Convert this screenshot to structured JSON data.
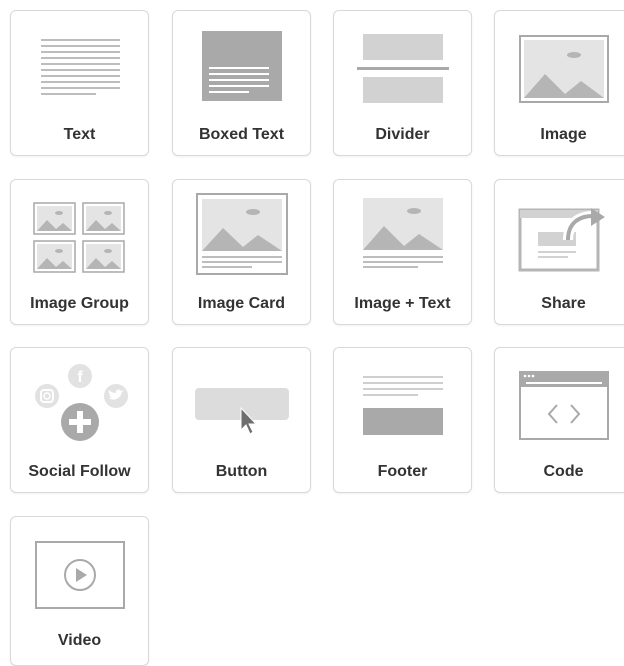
{
  "blocks": [
    {
      "label": "Text",
      "icon": "text-lines-icon"
    },
    {
      "label": "Boxed Text",
      "icon": "boxed-text-icon"
    },
    {
      "label": "Divider",
      "icon": "divider-icon"
    },
    {
      "label": "Image",
      "icon": "image-icon"
    },
    {
      "label": "Image Group",
      "icon": "image-group-icon"
    },
    {
      "label": "Image Card",
      "icon": "image-card-icon"
    },
    {
      "label": "Image + Text",
      "icon": "image-text-icon"
    },
    {
      "label": "Share",
      "icon": "share-icon"
    },
    {
      "label": "Social Follow",
      "icon": "social-follow-icon"
    },
    {
      "label": "Button",
      "icon": "button-icon"
    },
    {
      "label": "Footer",
      "icon": "footer-icon"
    },
    {
      "label": "Code",
      "icon": "code-icon"
    },
    {
      "label": "Video",
      "icon": "video-icon"
    }
  ],
  "colors": {
    "icon": "#b8b8b8",
    "icon_dark": "#a9a9a9",
    "border": "#d9d9d9",
    "label": "#333333"
  }
}
